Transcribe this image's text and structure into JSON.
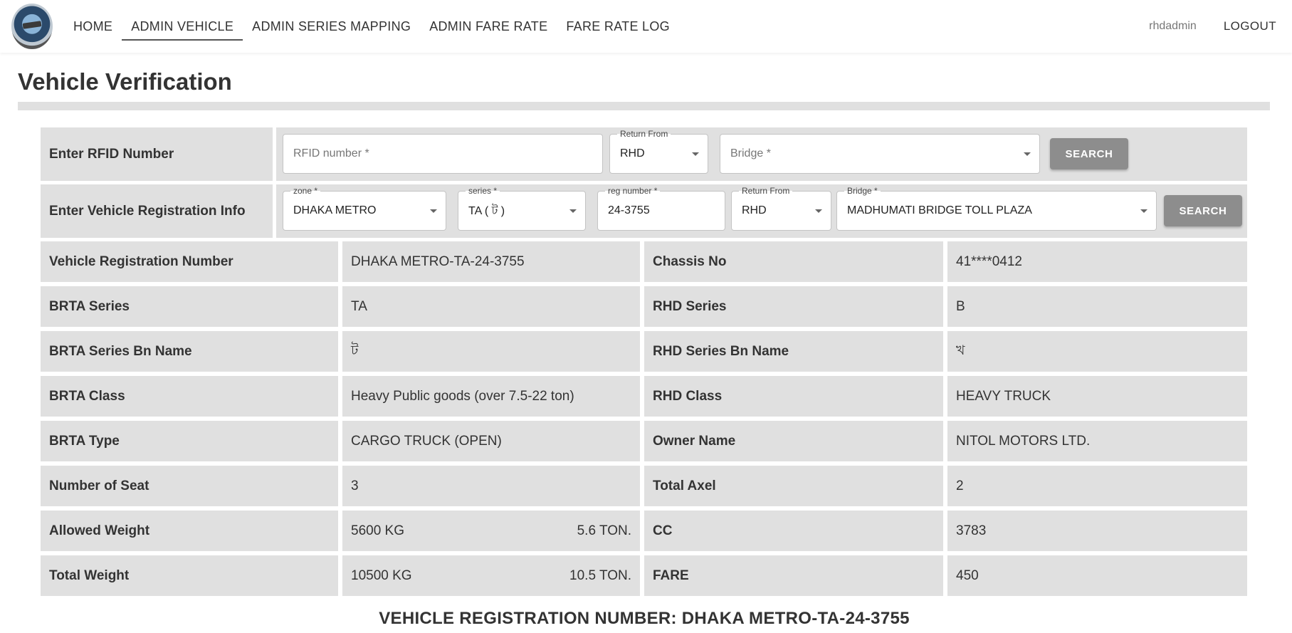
{
  "nav": {
    "links": [
      "HOME",
      "ADMIN VEHICLE",
      "ADMIN SERIES MAPPING",
      "ADMIN FARE RATE",
      "FARE RATE LOG"
    ],
    "active": "ADMIN VEHICLE",
    "username": "rhdadmin",
    "logout": "LOGOUT"
  },
  "page_title": "Vehicle Verification",
  "rfid_row": {
    "label": "Enter RFID Number",
    "rfid_placeholder": "RFID number *",
    "return_from_label": "Return From",
    "return_from_value": "RHD",
    "bridge_placeholder": "Bridge *",
    "search": "SEARCH"
  },
  "reg_row": {
    "label": "Enter Vehicle Registration Info",
    "zone_label": "zone *",
    "zone_value": "DHAKA METRO",
    "series_label": "series *",
    "series_value": "TA ( ট )",
    "reg_label": "reg number *",
    "reg_value": "24-3755",
    "return_from_label": "Return From",
    "return_from_value": "RHD",
    "bridge_label": "Bridge *",
    "bridge_value": "MADHUMATI BRIDGE TOLL PLAZA",
    "search": "SEARCH"
  },
  "details": [
    {
      "k1": "Vehicle Registration Number",
      "v1": "DHAKA METRO-TA-24-3755",
      "v1r": "",
      "k2": "Chassis No",
      "v2": "41****0412"
    },
    {
      "k1": "BRTA Series",
      "v1": "TA",
      "v1r": "",
      "k2": "RHD Series",
      "v2": "B"
    },
    {
      "k1": "BRTA Series Bn Name",
      "v1": "ট",
      "v1r": "",
      "k2": "RHD Series Bn Name",
      "v2": "খ"
    },
    {
      "k1": "BRTA Class",
      "v1": "Heavy Public goods (over 7.5-22 ton)",
      "v1r": "",
      "k2": "RHD Class",
      "v2": "HEAVY TRUCK"
    },
    {
      "k1": "BRTA Type",
      "v1": "CARGO TRUCK (OPEN)",
      "v1r": "",
      "k2": "Owner Name",
      "v2": "NITOL MOTORS LTD."
    },
    {
      "k1": "Number of Seat",
      "v1": "3",
      "v1r": "",
      "k2": "Total Axel",
      "v2": "2"
    },
    {
      "k1": "Allowed Weight",
      "v1": "5600 KG",
      "v1r": "5.6 TON.",
      "k2": "CC",
      "v2": "3783"
    },
    {
      "k1": "Total Weight",
      "v1": "10500 KG",
      "v1r": "10.5 TON.",
      "k2": "FARE",
      "v2": "450"
    }
  ],
  "footer_title": "VEHICLE REGISTRATION NUMBER: DHAKA METRO-TA-24-3755"
}
